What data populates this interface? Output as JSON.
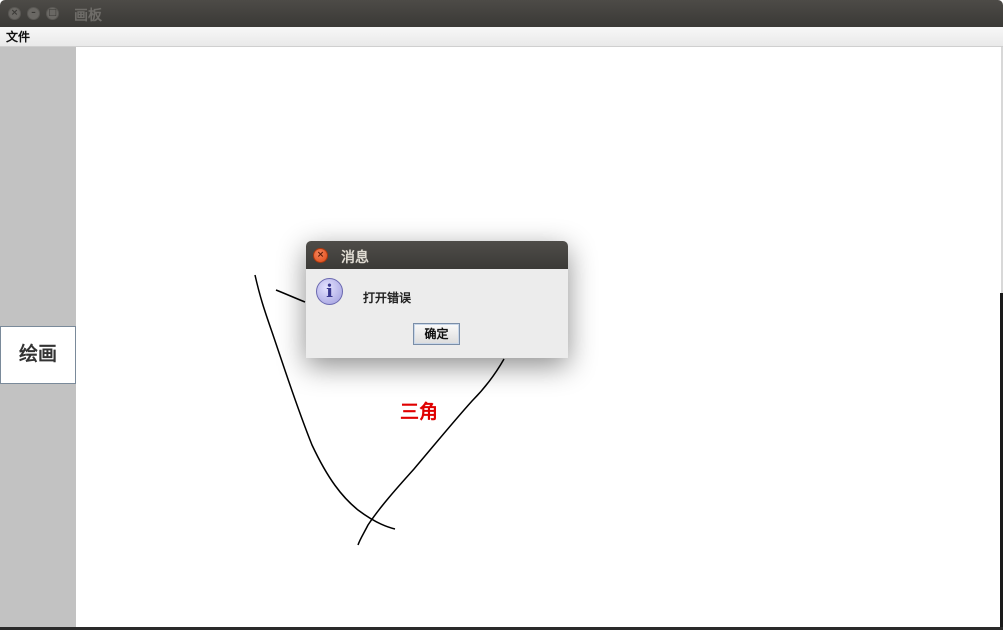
{
  "window": {
    "title": "画板",
    "close_icon": "close-icon",
    "minimize_icon": "minimize-icon",
    "maximize_icon": "maximize-icon"
  },
  "menubar": {
    "items": [
      {
        "label": "文件"
      }
    ]
  },
  "sidebar": {
    "draw_button_label": "绘画"
  },
  "canvas": {
    "shape_label": "三角",
    "shape_label_color": "#e00000",
    "stroke_color": "#000000"
  },
  "dialog": {
    "title": "消息",
    "icon": "info-icon",
    "message": "打开错误",
    "ok_label": "确定"
  }
}
